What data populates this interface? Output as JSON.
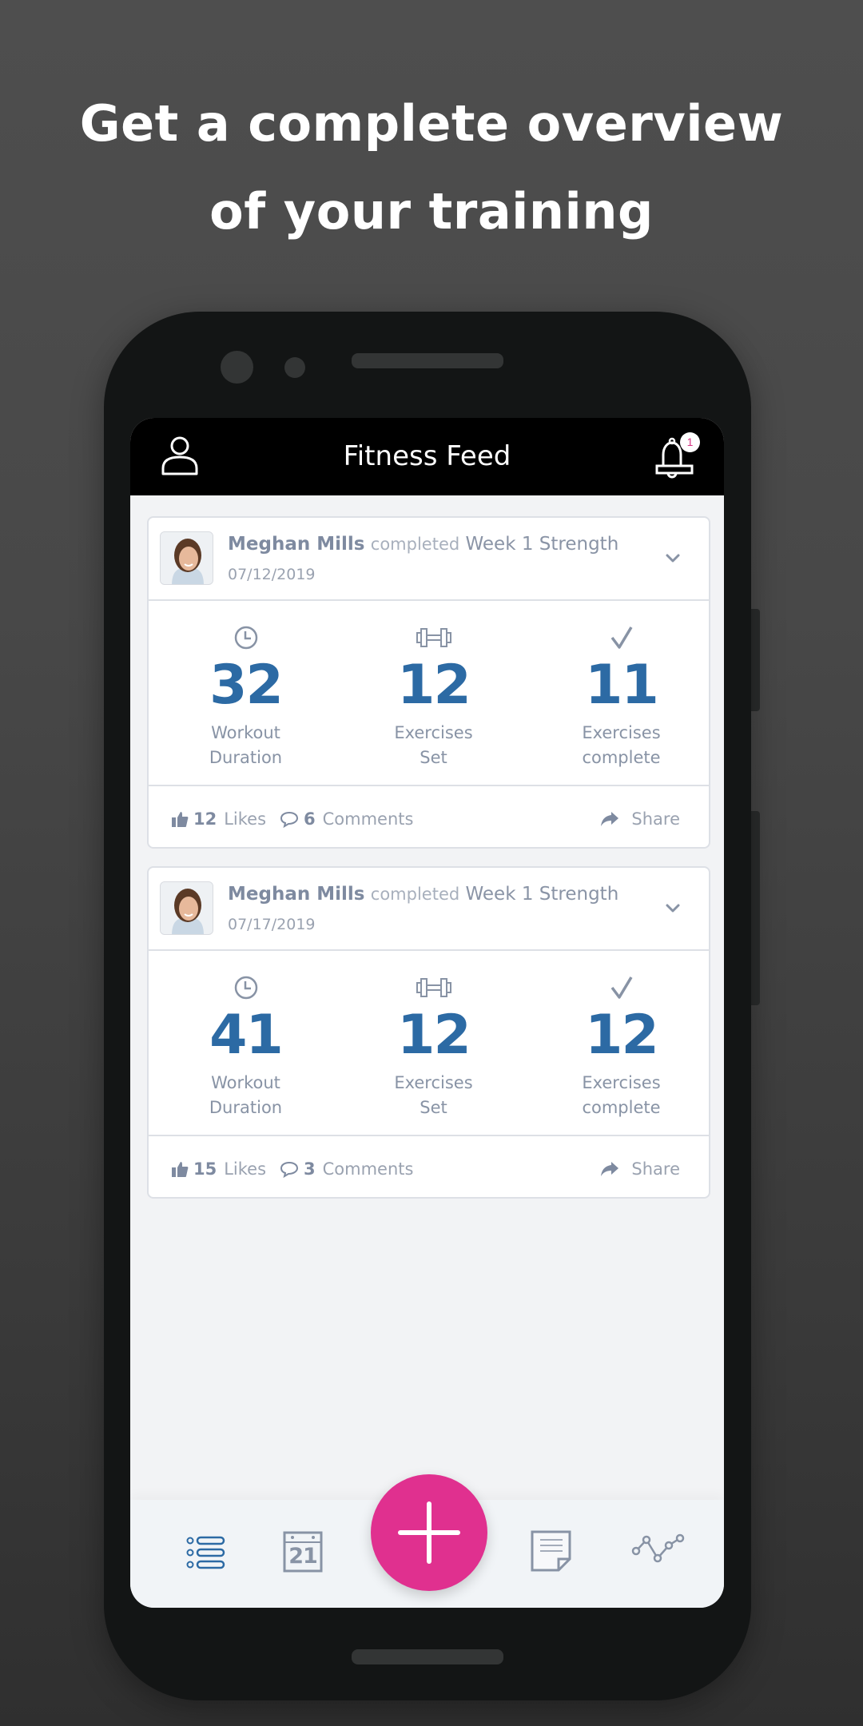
{
  "promo": {
    "line1": "Get a complete overview",
    "line2": "of your training"
  },
  "appbar": {
    "title": "Fitness Feed",
    "profile_icon": "user-icon",
    "notifications_icon": "bell-icon",
    "notification_count": "1"
  },
  "feed": [
    {
      "user": "Meghan Mills",
      "verb": "completed",
      "workout": "Week 1 Strength",
      "date": "07/12/2019",
      "stats": [
        {
          "icon": "clock-icon",
          "value": "32",
          "label1": "Workout",
          "label2": "Duration"
        },
        {
          "icon": "dumbbell-icon",
          "value": "12",
          "label1": "Exercises",
          "label2": "Set"
        },
        {
          "icon": "check-icon",
          "value": "11",
          "label1": "Exercises",
          "label2": "complete"
        }
      ],
      "likes_count": "12",
      "likes_label": "Likes",
      "comments_count": "6",
      "comments_label": "Comments",
      "share_label": "Share"
    },
    {
      "user": "Meghan Mills",
      "verb": "completed",
      "workout": "Week 1 Strength",
      "date": "07/17/2019",
      "stats": [
        {
          "icon": "clock-icon",
          "value": "41",
          "label1": "Workout",
          "label2": "Duration"
        },
        {
          "icon": "dumbbell-icon",
          "value": "12",
          "label1": "Exercises",
          "label2": "Set"
        },
        {
          "icon": "check-icon",
          "value": "12",
          "label1": "Exercises",
          "label2": "complete"
        }
      ],
      "likes_count": "15",
      "likes_label": "Likes",
      "comments_count": "3",
      "comments_label": "Comments",
      "share_label": "Share"
    }
  ],
  "navbar": {
    "items": [
      {
        "icon": "list-icon",
        "active": true
      },
      {
        "icon": "calendar-icon",
        "calendar_day": "21"
      },
      {
        "icon": "add-icon"
      },
      {
        "icon": "notes-icon"
      },
      {
        "icon": "progress-chart-icon"
      }
    ]
  },
  "colors": {
    "accent": "#e0308f",
    "stat_value": "#2c6aa4",
    "muted_text": "#8893a5",
    "appbar_bg": "#000000"
  }
}
